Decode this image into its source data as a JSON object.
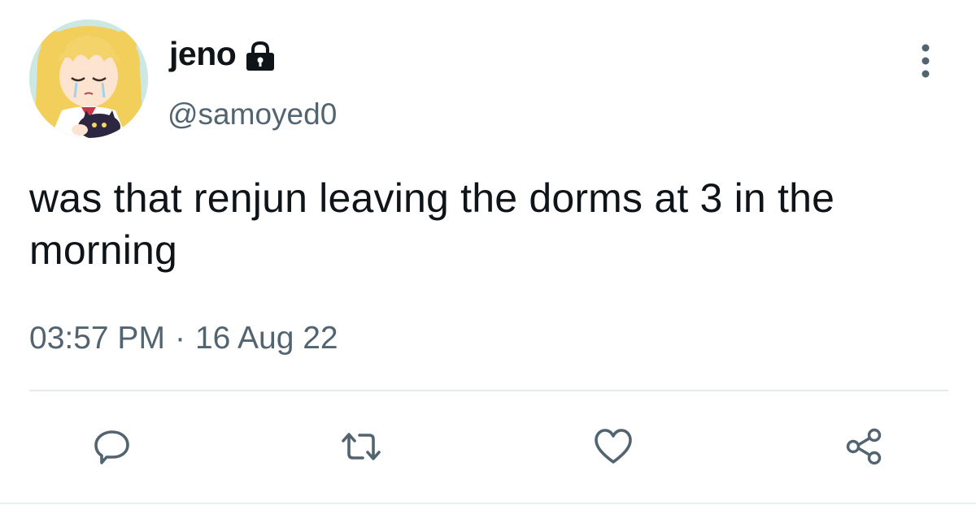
{
  "user": {
    "display_name": "jeno",
    "handle": "@samoyed0",
    "avatar_icon": "anime-avatar",
    "protected_icon": "lock-icon"
  },
  "tweet": {
    "text": "was that renjun leaving the dorms at 3 in the morning",
    "time": "03:57 PM",
    "separator": "·",
    "date": "16 Aug 22"
  },
  "actions": [
    {
      "name": "reply",
      "icon": "reply-icon"
    },
    {
      "name": "retweet",
      "icon": "retweet-icon"
    },
    {
      "name": "like",
      "icon": "heart-icon"
    },
    {
      "name": "share",
      "icon": "share-icon"
    }
  ],
  "more_icon": "more-vertical-icon",
  "colors": {
    "text_primary": "#0f1419",
    "text_secondary": "#536471",
    "icon": "#536471",
    "divider": "#e6e9ec"
  }
}
